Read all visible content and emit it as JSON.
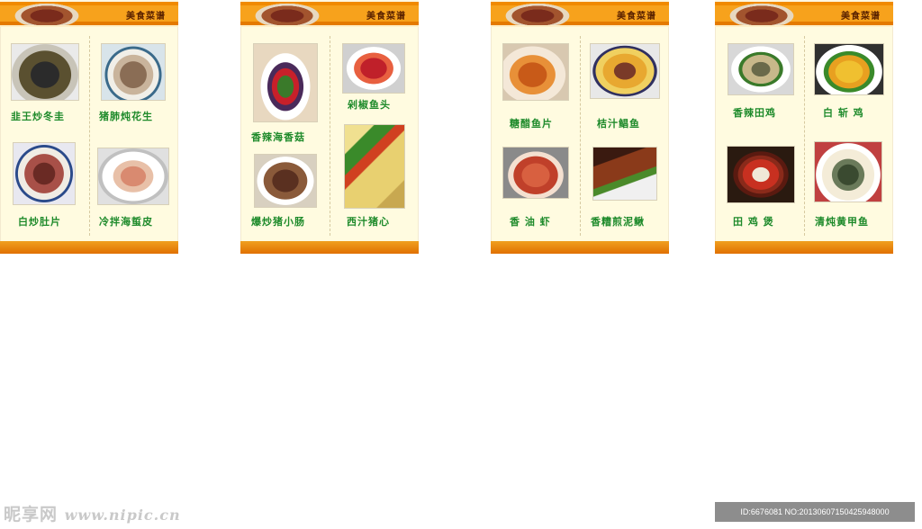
{
  "cards": [
    {
      "title": "美食菜谱",
      "dishes": [
        {
          "name": "韭王炒冬圭",
          "photo": "dark-stir-fry-photo"
        },
        {
          "name": "猪肺炖花生",
          "photo": "soup-bowl-photo"
        },
        {
          "name": "白炒肚片",
          "photo": "tripe-plate-photo"
        },
        {
          "name": "冷拌海蜇皮",
          "photo": "jellyfish-salad-photo"
        }
      ]
    },
    {
      "title": "美食菜谱",
      "dishes": [
        {
          "name": "香辣海香菇",
          "photo": "spicy-mushroom-photo"
        },
        {
          "name": "剁椒鱼头",
          "photo": "chili-fish-head-photo"
        },
        {
          "name": "爆炒猪小肠",
          "photo": "pork-intestine-photo"
        },
        {
          "name": "西汁猪心",
          "photo": "pork-heart-photo"
        }
      ]
    },
    {
      "title": "美食菜谱",
      "dishes": [
        {
          "name": "糖醋鱼片",
          "photo": "sweet-sour-fish-photo"
        },
        {
          "name": "桔汁鲳鱼",
          "photo": "orange-pomfret-photo"
        },
        {
          "name": "香 油 虾",
          "photo": "sesame-shrimp-photo"
        },
        {
          "name": "香糟煎泥鳅",
          "photo": "fried-loach-photo"
        }
      ]
    },
    {
      "title": "美食菜谱",
      "dishes": [
        {
          "name": "香辣田鸡",
          "photo": "spicy-frog-photo"
        },
        {
          "name": "白 斩 鸡",
          "photo": "white-chicken-photo"
        },
        {
          "name": "田 鸡 煲",
          "photo": "frog-pot-photo"
        },
        {
          "name": "清炖黄甲鱼",
          "photo": "turtle-soup-photo"
        }
      ]
    }
  ],
  "watermark": {
    "brand": "昵享网",
    "url": "www.nipic.cn"
  },
  "image_id": "ID:6676081 NO:20130607150425948000",
  "colors": {
    "header_orange": "#f7a21c",
    "footer_orange": "#e07000",
    "card_bg": "#fffbe0",
    "label_green": "#1d8a2a"
  }
}
